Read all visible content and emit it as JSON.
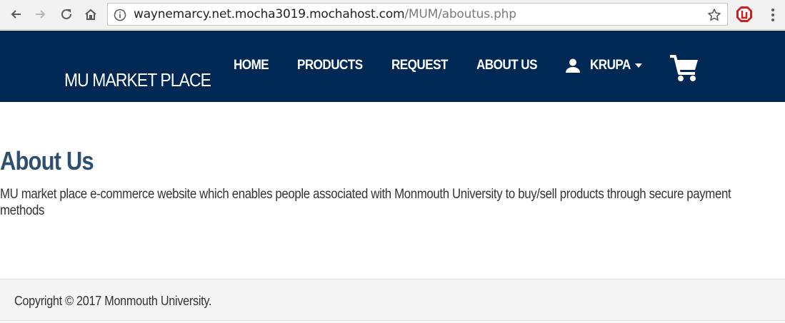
{
  "browser": {
    "url_host": "waynemarcy.net.mocha3019.mochahost.com",
    "url_path": "/MUM/aboutus.php",
    "icons": [
      "back-icon",
      "forward-icon",
      "reload-icon",
      "home-icon",
      "info-icon",
      "star-icon",
      "extension-icon",
      "menu-icon"
    ]
  },
  "navbar": {
    "brand": "MU MARKET PLACE",
    "links": [
      "HOME",
      "PRODUCTS",
      "REQUEST",
      "ABOUT US"
    ],
    "user": "KRUPA",
    "background": "#002855"
  },
  "main": {
    "title": "About Us",
    "description": "MU market place e-commerce website which enables people associated with Monmouth University to buy/sell products through secure payment methods"
  },
  "footer": {
    "copyright": "Copyright © 2017 Monmouth University."
  }
}
